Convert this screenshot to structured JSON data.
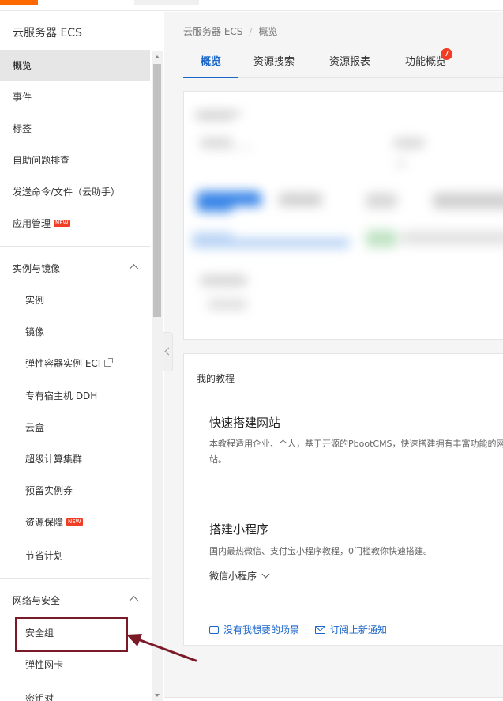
{
  "sidebar": {
    "title": "云服务器 ECS",
    "items": [
      {
        "label": "概览",
        "active": true
      },
      {
        "label": "事件"
      },
      {
        "label": "标签"
      },
      {
        "label": "自助问题排查"
      },
      {
        "label": "发送命令/文件（云助手）"
      },
      {
        "label": "应用管理",
        "badge": "NEW"
      }
    ],
    "group_instances": {
      "header": "实例与镜像",
      "items": [
        {
          "label": "实例"
        },
        {
          "label": "镜像"
        },
        {
          "label": "弹性容器实例 ECI"
        },
        {
          "label": "专有宿主机 DDH"
        },
        {
          "label": "云盒"
        },
        {
          "label": "超级计算集群"
        },
        {
          "label": "预留实例券"
        },
        {
          "label": "资源保障",
          "badge": "NEW"
        },
        {
          "label": "节省计划"
        }
      ]
    },
    "group_network": {
      "header": "网络与安全",
      "items": [
        {
          "label": "安全组"
        },
        {
          "label": "弹性网卡"
        },
        {
          "label": "密钥对"
        }
      ]
    }
  },
  "breadcrumb": {
    "root": "云服务器 ECS",
    "separator": "/",
    "current": "概览"
  },
  "tabs": [
    {
      "label": "概览",
      "active": true
    },
    {
      "label": "资源搜索"
    },
    {
      "label": "资源报表"
    },
    {
      "label": "功能概览",
      "badge": "7"
    }
  ],
  "tutorials": {
    "title": "我的教程",
    "items": [
      {
        "title": "快速搭建网站",
        "desc": "本教程适用企业、个人，基于开源的PbootCMS，快速搭建拥有丰富功能的网站。"
      },
      {
        "title": "搭建小程序",
        "desc": "国内最热微信、支付宝小程序教程，0门槛教你快速搭建。",
        "link": "微信小程序"
      }
    ],
    "footer": {
      "no_scene": "没有我想要的场景",
      "subscribe": "订阅上新通知"
    }
  },
  "colors": {
    "accent": "#1a66c9",
    "badge": "#f23c24",
    "highlight": "#7a1a28",
    "brand": "#ff6a00"
  }
}
